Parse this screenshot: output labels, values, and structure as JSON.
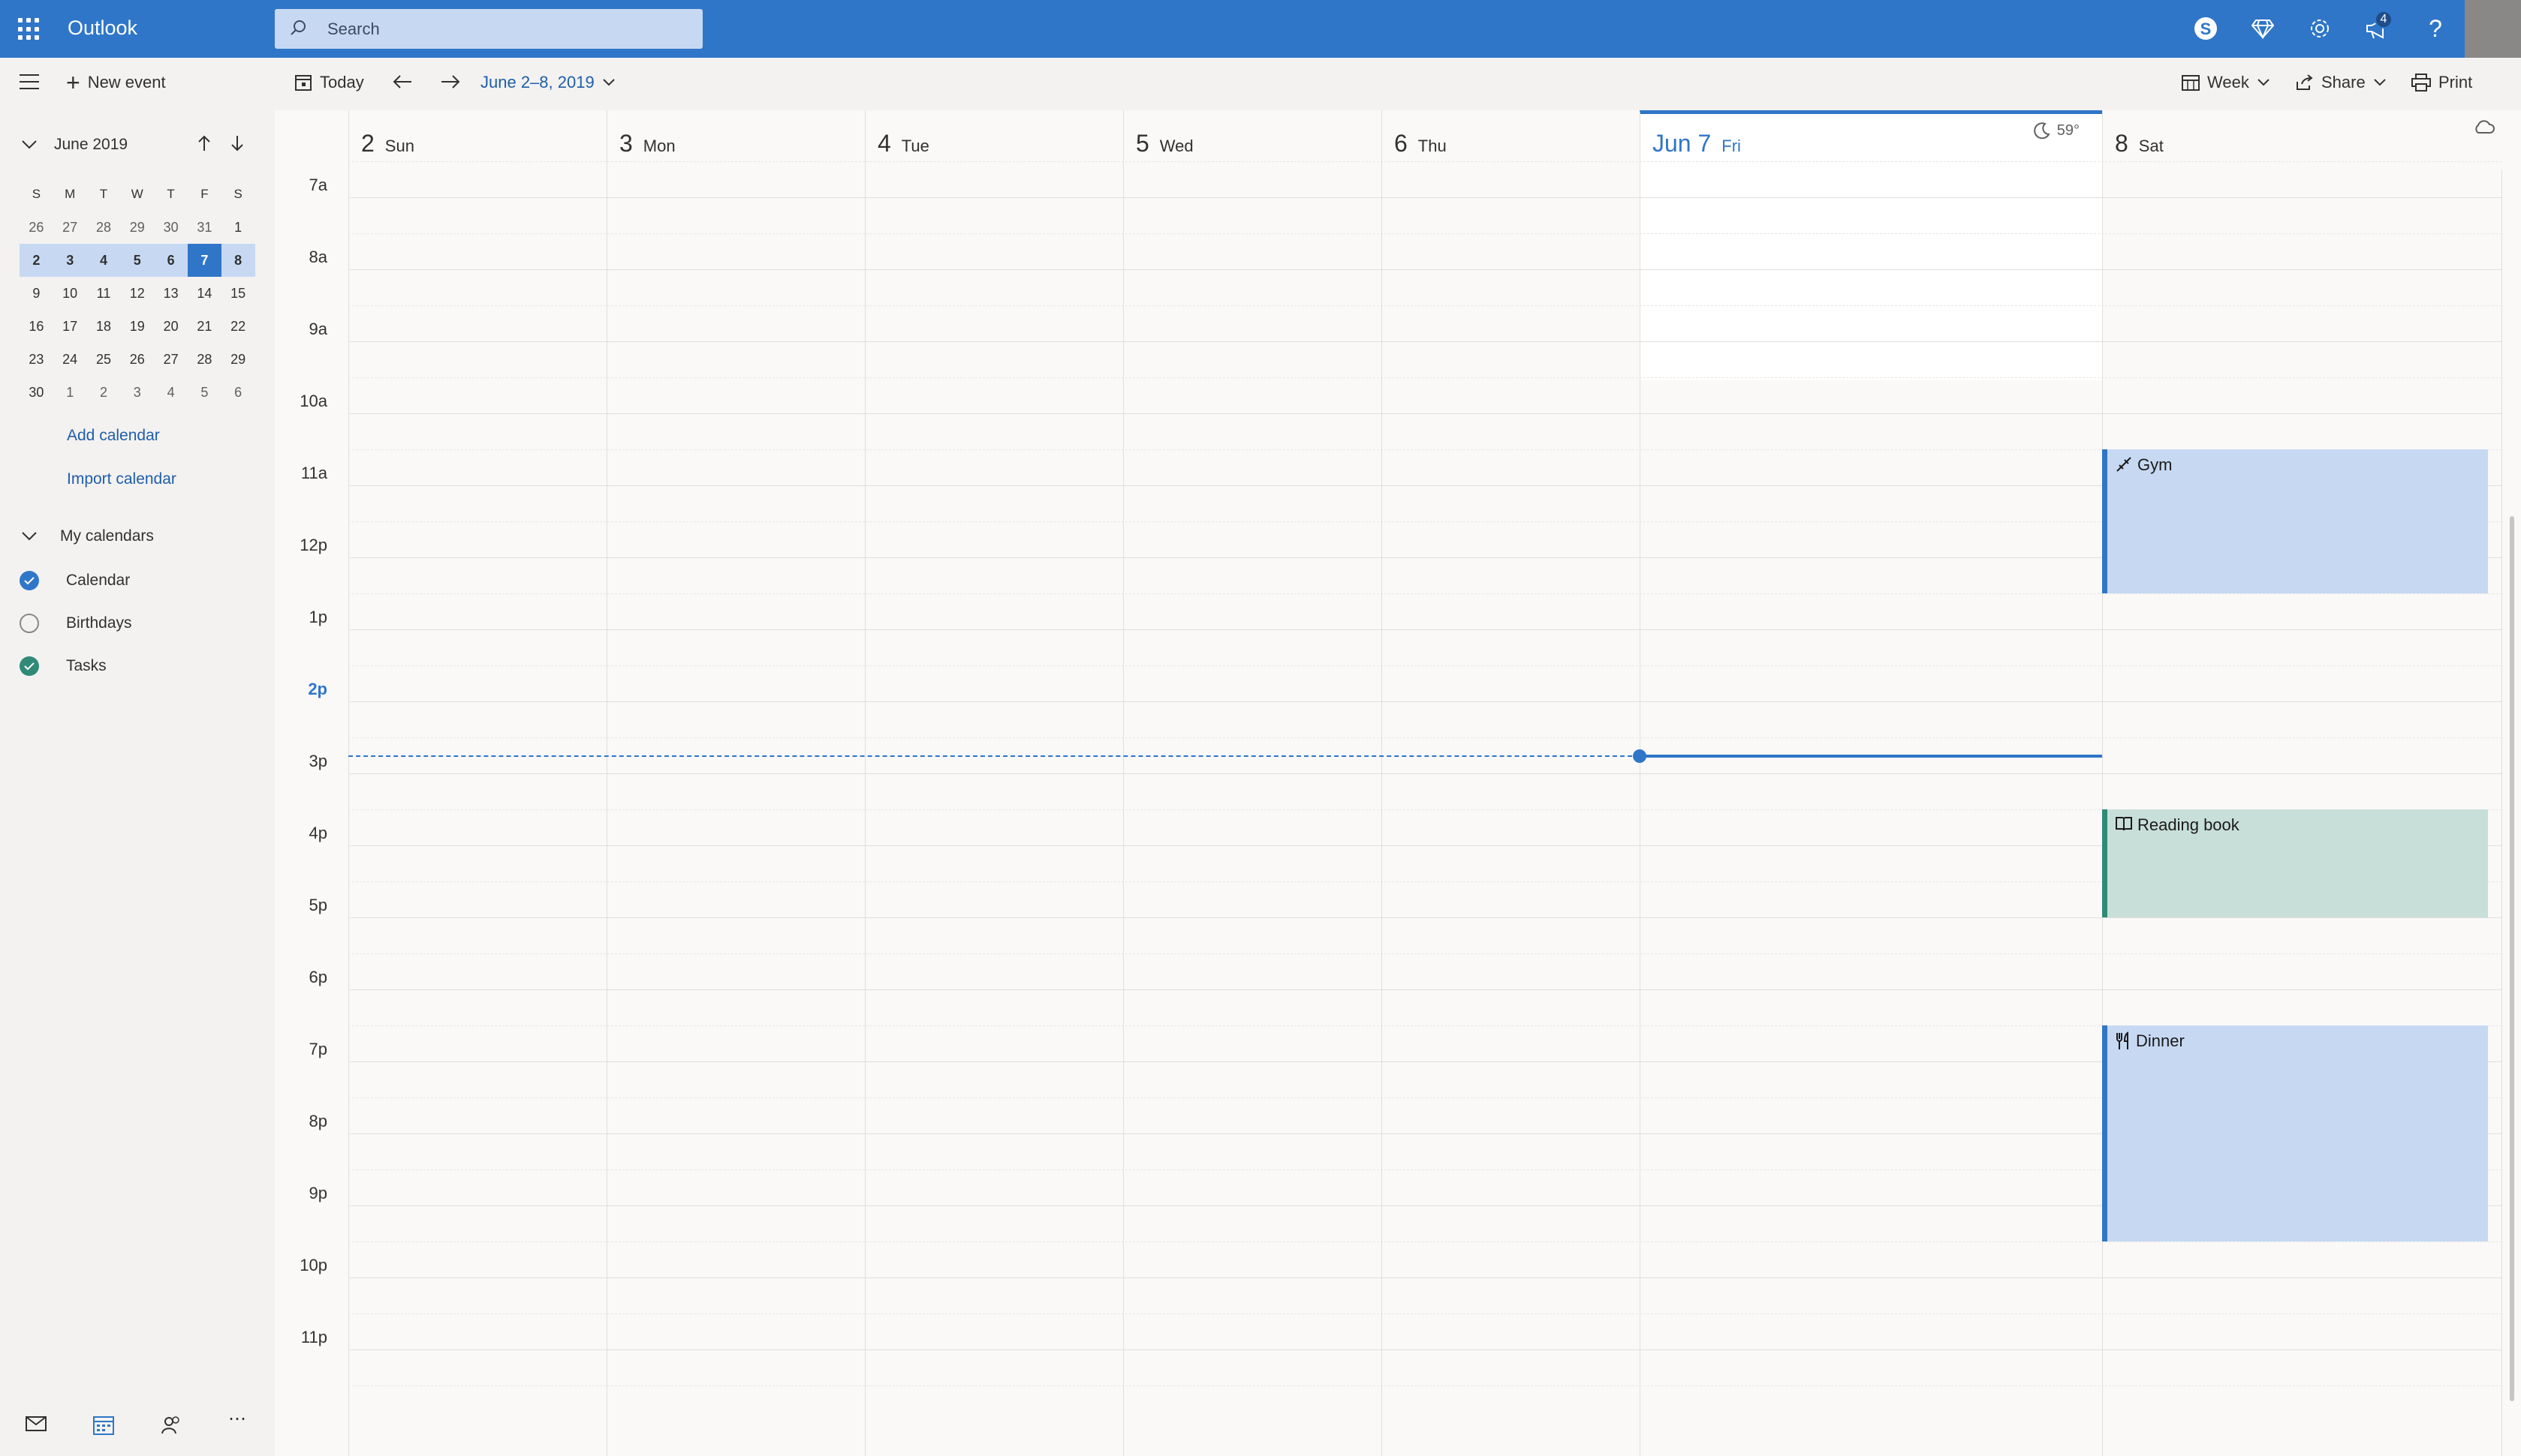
{
  "topbar": {
    "app_name": "Outlook",
    "search_placeholder": "Search",
    "notification_count": "4",
    "icons": [
      "waffle-icon",
      "skype-icon",
      "premium-diamond-icon",
      "settings-gear-icon",
      "megaphone-icon",
      "help-icon"
    ]
  },
  "commandbar": {
    "new_event": "New event",
    "today": "Today",
    "date_range": "June 2–8, 2019",
    "view": "Week",
    "share": "Share",
    "print": "Print"
  },
  "minical": {
    "month_label": "June 2019",
    "dow": [
      "S",
      "M",
      "T",
      "W",
      "T",
      "F",
      "S"
    ],
    "weeks": [
      [
        "26",
        "27",
        "28",
        "29",
        "30",
        "31",
        "1"
      ],
      [
        "2",
        "3",
        "4",
        "5",
        "6",
        "7",
        "8"
      ],
      [
        "9",
        "10",
        "11",
        "12",
        "13",
        "14",
        "15"
      ],
      [
        "16",
        "17",
        "18",
        "19",
        "20",
        "21",
        "22"
      ],
      [
        "23",
        "24",
        "25",
        "26",
        "27",
        "28",
        "29"
      ],
      [
        "30",
        "1",
        "2",
        "3",
        "4",
        "5",
        "6"
      ]
    ],
    "selected_week": 1,
    "today_index": 5
  },
  "leftpane": {
    "add_calendar": "Add calendar",
    "import_calendar": "Import calendar",
    "my_calendars": "My calendars",
    "calendars": [
      {
        "label": "Calendar",
        "checked": true,
        "color": "#2f76c8"
      },
      {
        "label": "Birthdays",
        "checked": false,
        "color": "#8a8886"
      },
      {
        "label": "Tasks",
        "checked": true,
        "color": "#2f8a77"
      }
    ],
    "bottom_icons": [
      "mail-icon",
      "calendar-icon",
      "people-icon",
      "more-icon"
    ]
  },
  "week": {
    "days": [
      {
        "num": "2",
        "name": "Sun"
      },
      {
        "num": "3",
        "name": "Mon"
      },
      {
        "num": "4",
        "name": "Tue"
      },
      {
        "num": "5",
        "name": "Wed"
      },
      {
        "num": "6",
        "name": "Thu"
      },
      {
        "num": "Jun 7",
        "name": "Fri",
        "today": true,
        "weather": "59°"
      },
      {
        "num": "8",
        "name": "Sat"
      }
    ],
    "hours": [
      "7a",
      "8a",
      "9a",
      "10a",
      "11a",
      "12p",
      "1p",
      "2p",
      "3p",
      "4p",
      "5p",
      "6p",
      "7p",
      "8p",
      "9p",
      "10p",
      "11p"
    ],
    "current_hour_label": "2p",
    "events": [
      {
        "title": "Gym",
        "icon": "dumbbell-icon",
        "day": "Sat",
        "start": "10a",
        "end": "12p"
      },
      {
        "title": "Reading book",
        "icon": "book-icon",
        "day": "Sat",
        "start": "3p",
        "end": "4:30p"
      },
      {
        "title": "Dinner",
        "icon": "dinner-icon",
        "day": "Sat",
        "start": "6p",
        "end": "9p"
      }
    ]
  },
  "colors": {
    "brand": "#2f76c8",
    "event_blue": "#c7d9f2",
    "event_green": "#c8dfd9",
    "green_accent": "#2f8a77"
  }
}
